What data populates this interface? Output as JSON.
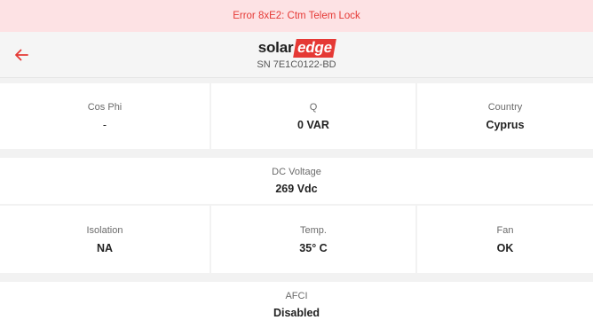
{
  "error_banner": {
    "text": "Error 8xE2: Ctm Telem Lock"
  },
  "header": {
    "logo_solar": "solar",
    "logo_edge": "edge",
    "serial": "SN 7E1C0122-BD"
  },
  "metrics": {
    "cos_phi": {
      "label": "Cos Phi",
      "value": "-"
    },
    "q": {
      "label": "Q",
      "value": "0 VAR"
    },
    "country": {
      "label": "Country",
      "value": "Cyprus"
    },
    "dc_voltage": {
      "label": "DC Voltage",
      "value": "269 Vdc"
    },
    "isolation": {
      "label": "Isolation",
      "value": "NA"
    },
    "temp": {
      "label": "Temp.",
      "value": "35° C"
    },
    "fan": {
      "label": "Fan",
      "value": "OK"
    },
    "afci": {
      "label": "AFCI",
      "value": "Disabled"
    }
  },
  "colors": {
    "accent": "#e53935",
    "error_bg": "#fde2e4",
    "background": "#f2f2f2"
  },
  "icons": {
    "back": "arrow-left-icon"
  }
}
